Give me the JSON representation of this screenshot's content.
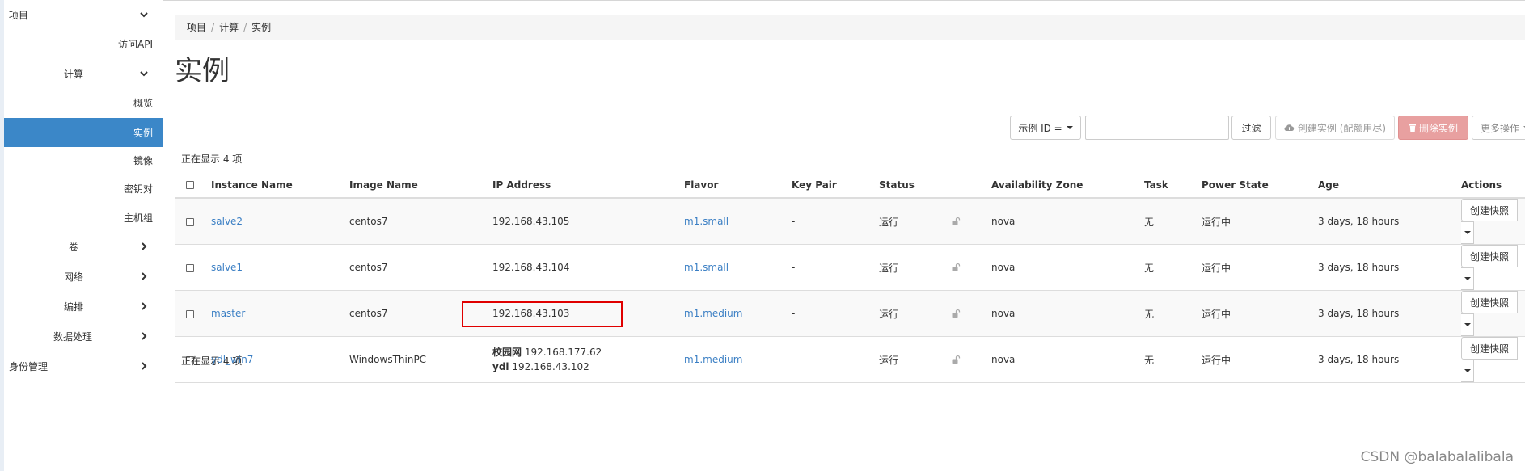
{
  "sidebar": {
    "items": [
      {
        "label": "项目",
        "chevron": "down",
        "active": false
      },
      {
        "label": "访问API",
        "chevron": "",
        "active": false
      },
      {
        "label": "计算",
        "chevron": "down",
        "active": false
      },
      {
        "label": "概览",
        "chevron": "",
        "active": false
      },
      {
        "label": "实例",
        "chevron": "",
        "active": true
      },
      {
        "label": "镜像",
        "chevron": "",
        "active": false
      },
      {
        "label": "密钥对",
        "chevron": "",
        "active": false
      },
      {
        "label": "主机组",
        "chevron": "",
        "active": false
      },
      {
        "label": "卷",
        "chevron": "right",
        "active": false
      },
      {
        "label": "网络",
        "chevron": "right",
        "active": false
      },
      {
        "label": "编排",
        "chevron": "right",
        "active": false
      },
      {
        "label": "数据处理",
        "chevron": "right",
        "active": false
      },
      {
        "label": "身份管理",
        "chevron": "right",
        "active": false
      }
    ]
  },
  "breadcrumb": {
    "items": [
      "项目",
      "计算",
      "实例"
    ],
    "separator": "/"
  },
  "page": {
    "title": "实例"
  },
  "toolbar": {
    "filter_field": "示例 ID =",
    "filter_value": "",
    "filter_button": "过滤",
    "create_button": "创建实例 (配额用尽)",
    "delete_button": "删除实例",
    "more_button": "更多操作"
  },
  "summary": {
    "count_top": "正在显示 4 项",
    "count_bottom": "正在显示 4 项"
  },
  "table": {
    "columns": [
      "Instance Name",
      "Image Name",
      "IP Address",
      "Flavor",
      "Key Pair",
      "Status",
      "Availability Zone",
      "Task",
      "Power State",
      "Age",
      "Actions"
    ],
    "rows": [
      {
        "name": "salve2",
        "image": "centos7",
        "ip": [
          {
            "label": "",
            "value": "192.168.43.105"
          }
        ],
        "flavor": "m1.small",
        "key_pair": "-",
        "status": "运行",
        "zone": "nova",
        "task": "无",
        "power": "运行中",
        "age": "3 days, 18 hours",
        "action": "创建快照"
      },
      {
        "name": "salve1",
        "image": "centos7",
        "ip": [
          {
            "label": "",
            "value": "192.168.43.104"
          }
        ],
        "flavor": "m1.small",
        "key_pair": "-",
        "status": "运行",
        "zone": "nova",
        "task": "无",
        "power": "运行中",
        "age": "3 days, 18 hours",
        "action": "创建快照"
      },
      {
        "name": "master",
        "image": "centos7",
        "ip": [
          {
            "label": "",
            "value": "192.168.43.103"
          }
        ],
        "flavor": "m1.medium",
        "key_pair": "-",
        "status": "运行",
        "zone": "nova",
        "task": "无",
        "power": "运行中",
        "age": "3 days, 18 hours",
        "action": "创建快照"
      },
      {
        "name": "ydl_win7",
        "image": "WindowsThinPC",
        "ip": [
          {
            "label": "校园网",
            "value": "192.168.177.62"
          },
          {
            "label": "ydl",
            "value": "192.168.43.102"
          }
        ],
        "flavor": "m1.medium",
        "key_pair": "-",
        "status": "运行",
        "zone": "nova",
        "task": "无",
        "power": "运行中",
        "age": "3 days, 18 hours",
        "action": "创建快照"
      }
    ]
  },
  "watermark": "CSDN @balabalalibala",
  "colors": {
    "active_nav": "#3b87c8",
    "link": "#3b7fc4",
    "danger": "#e8a0a0",
    "highlight_box": "#e00000"
  }
}
